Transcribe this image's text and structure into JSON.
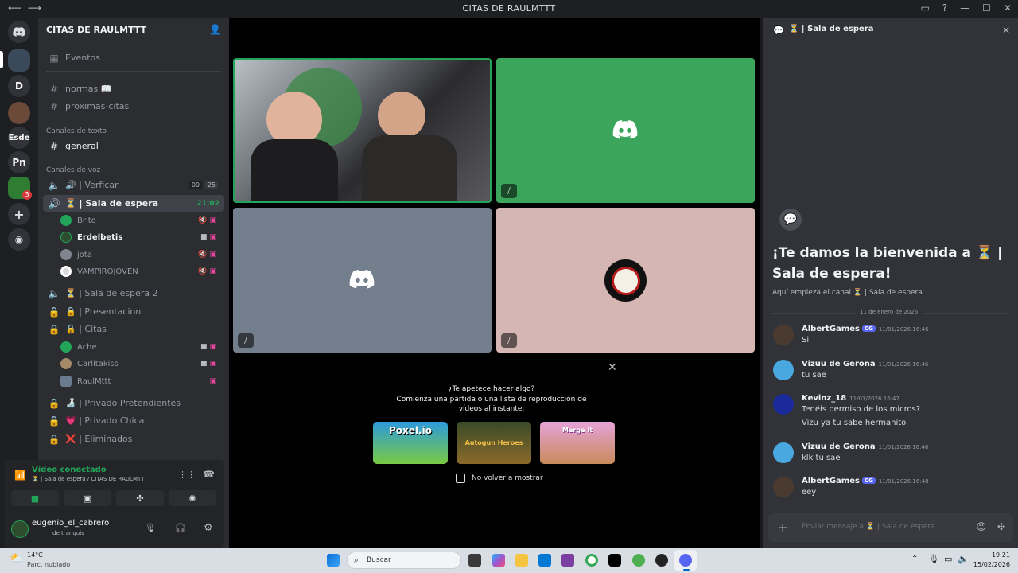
{
  "window": {
    "title": "CITAS DE RAULMTTT"
  },
  "guilds": {
    "items": [
      "D",
      "Esde",
      "Pn"
    ],
    "notify_badge": "3"
  },
  "server": {
    "name": "CITAS DE RAULMTTT",
    "events_label": "Eventos",
    "top_channels": [
      "normas 📖",
      "proximas-citas"
    ],
    "text_category": "Canales de texto",
    "text_channels": [
      "general"
    ],
    "voice_category": "Canales de voz",
    "voice_channels": [
      {
        "name": "🔊 | Verficar",
        "badge_a": "00",
        "badge_b": "25"
      },
      {
        "name": "⏳ | Sala de espera",
        "timer": "21:02"
      },
      {
        "name": "⏳ | Sala de espera 2"
      },
      {
        "name": "🔒 | Presentacion"
      },
      {
        "name": "🔒 | Citas"
      },
      {
        "name": "🍶 | Privado Pretendientes"
      },
      {
        "name": "💗 | Privado Chica"
      },
      {
        "name": "❌ | Eliminados"
      }
    ],
    "sala_users": [
      "Brito",
      "Erdelbetis",
      "jota",
      "VAMPIROJOVEN"
    ],
    "citas_users": [
      "Ache",
      "Carlitakiss",
      "RaulMttt"
    ]
  },
  "voice_status": {
    "title": "Vídeo conectado",
    "subtitle": "⏳ | Sala de espera / CITAS DE RAULMTTT"
  },
  "current_user": {
    "name": "eugenio_el_cabrero",
    "status": "de tranquis"
  },
  "activity": {
    "question": "¿Te apetece hacer algo?",
    "description": "Comienza una partida o una lista de reproducción de vídeos al instante.",
    "games": [
      "Poxel.io",
      "Autogun Heroes",
      "Merge It"
    ],
    "checkbox_label": "No volver a mostrar"
  },
  "side_panel": {
    "header": "⏳ | Sala de espera",
    "welcome_title": "¡Te damos la bienvenida a ⏳ | Sala de espera!",
    "welcome_subtitle": "Aquí empieza el canal ⏳ | Sala de espera.",
    "date_divider": "11 de enero de 2026",
    "messages": [
      {
        "author": "AlbertGames",
        "tag": "CG",
        "time": "11/01/2026 16:46",
        "lines": [
          "Sii"
        ]
      },
      {
        "author": "Vizuu de Gerona",
        "time": "11/01/2026 16:46",
        "lines": [
          "tu sae"
        ]
      },
      {
        "author": "Kevinz_18",
        "time": "11/01/2026 16:47",
        "lines": [
          "Tenéis permiso de los micros?",
          "Vizu ya tu sabe hermanito"
        ]
      },
      {
        "author": "Vizuu de Gerona",
        "time": "11/01/2026 16:48",
        "lines": [
          "klk tu sae"
        ]
      },
      {
        "author": "AlbertGames",
        "tag": "CG",
        "time": "11/01/2026 16:48",
        "lines": [
          "eey"
        ]
      }
    ],
    "input_placeholder": "Enviar mensaje a ⏳ | Sala de espera"
  },
  "taskbar": {
    "weather_temp": "14°C",
    "weather_desc": "Parc. nublado",
    "search_placeholder": "Buscar",
    "time": "19:21",
    "date": "15/02/2026"
  },
  "colors": {
    "green_tile": "#3ba55c",
    "gray_tile": "#747f8d",
    "pink_tile": "#d6b6b2",
    "accent": "#5865f2",
    "voice_green": "#23a559"
  }
}
